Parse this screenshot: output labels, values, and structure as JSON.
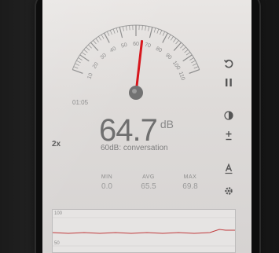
{
  "gauge": {
    "scale_labels": [
      "10",
      "20",
      "30",
      "40",
      "50",
      "60",
      "70",
      "80",
      "90",
      "100",
      "110"
    ],
    "needle_reading_db": 64.7,
    "needle_color": "#d7151b"
  },
  "timer": "01:05",
  "reading": {
    "value": "64.7",
    "unit": "dB",
    "reference": "60dB: conversation"
  },
  "zoom_label": "2x",
  "stats": {
    "min_label": "MIN",
    "min_value": "0.0",
    "avg_label": "AVG",
    "avg_value": "65.5",
    "max_label": "MAX",
    "max_value": "69.8"
  },
  "graph": {
    "y_top": "100",
    "y_bottom": "50",
    "line_color": "#c0393b"
  },
  "toolbar_icons": [
    "reset-icon",
    "pause-icon",
    "theme-icon",
    "calibrate-icon",
    "weighting-icon",
    "settings-icon"
  ]
}
